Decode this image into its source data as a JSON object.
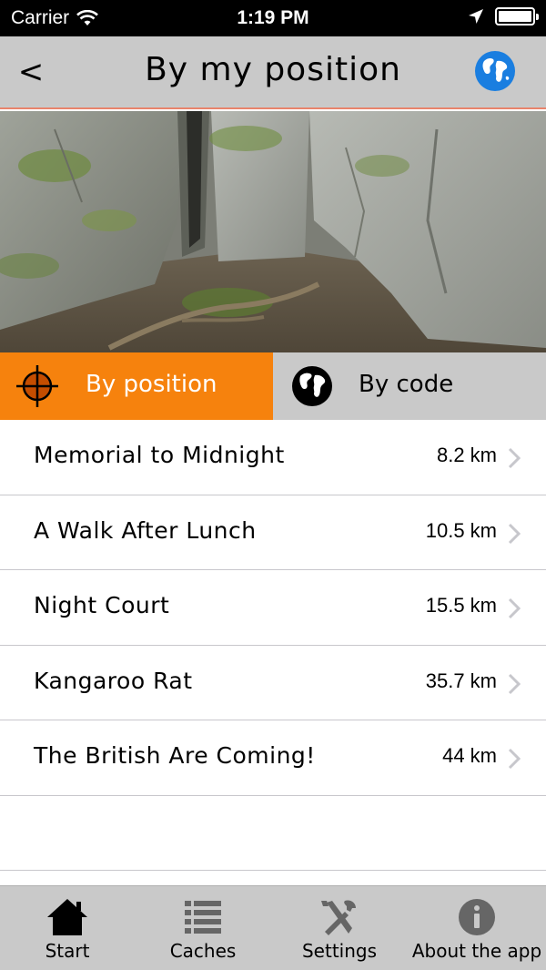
{
  "status_bar": {
    "carrier": "Carrier",
    "time": "1:19 PM",
    "battery_level": 1.0
  },
  "nav": {
    "back_label": "<",
    "title": "By my position",
    "globe_icon": "globe-icon"
  },
  "tabs": [
    {
      "label": "By position",
      "icon": "crosshair-icon",
      "active": true,
      "color": "#f6820d"
    },
    {
      "label": "By code",
      "icon": "globe-icon",
      "active": false,
      "color": "#c9c9c9"
    }
  ],
  "caches": [
    {
      "name": "Memorial to Midnight",
      "distance": "8.2 km"
    },
    {
      "name": "A Walk After Lunch",
      "distance": "10.5 km"
    },
    {
      "name": "Night Court",
      "distance": "15.5 km"
    },
    {
      "name": "Kangaroo Rat",
      "distance": "35.7 km"
    },
    {
      "name": "The British Are Coming!",
      "distance": "44 km"
    }
  ],
  "tab_bar": [
    {
      "label": "Start",
      "icon": "home-icon",
      "selected": true
    },
    {
      "label": "Caches",
      "icon": "list-icon",
      "selected": false
    },
    {
      "label": "Settings",
      "icon": "tools-icon",
      "selected": false
    },
    {
      "label": "About the app",
      "icon": "info-icon",
      "selected": false
    }
  ],
  "colors": {
    "accent": "#f6820d",
    "bar": "#c9c9c9",
    "globe_blue": "#1a7ee0"
  }
}
